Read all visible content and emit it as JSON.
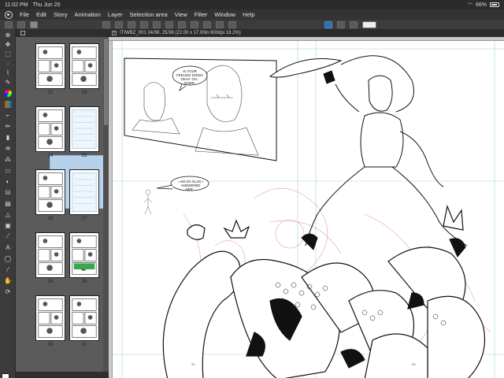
{
  "status": {
    "time": "11:02 PM",
    "date": "Thu Jun 20",
    "battery": "66%",
    "battery_level": 0.66
  },
  "menu": {
    "items": [
      "File",
      "Edit",
      "Story",
      "Animation",
      "Layer",
      "Selection area",
      "View",
      "Filter",
      "Window",
      "Help"
    ]
  },
  "navigator": {
    "pages": [
      {
        "label": "22"
      },
      {
        "label": "23"
      },
      {
        "label": "24"
      },
      {
        "label": "25"
      },
      {
        "label": "26"
      },
      {
        "label": "27"
      },
      {
        "label": "28"
      },
      {
        "label": "29"
      },
      {
        "label": "30"
      },
      {
        "label": "31"
      }
    ]
  },
  "document": {
    "tab_title": "ITIWBZ_001 24/38, 25/38 (22.00 x 17.00in 600dpi 18.2%)",
    "bubble1": "IS YOUR FEELING DOING OKAY- OH.. DAMN.",
    "bubble2": "I AM SO GLAD I ANSWERED HER...",
    "page_left": "24",
    "page_right": "25"
  },
  "colors": {
    "accent": "#2f6fb5",
    "selection": "#b6d2ea",
    "sketch_red": "#e8a0a0"
  },
  "icons": [
    "brush-icon",
    "pen-icon",
    "eraser-icon",
    "fill-icon",
    "text-icon",
    "color-wheel-icon",
    "layer-icon",
    "undo-icon",
    "redo-icon",
    "zoom-icon"
  ]
}
